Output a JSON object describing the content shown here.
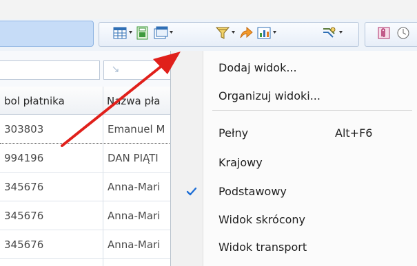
{
  "toolbar": {
    "buttons": [
      {
        "name": "columns-icon",
        "color": "#2f6fb5"
      },
      {
        "name": "export-icon",
        "color": "#3d9a3d"
      },
      {
        "name": "views-icon",
        "color": "#2f6fb5"
      },
      {
        "name": "filter-icon",
        "color": "#8a6d1f"
      },
      {
        "name": "arrow-action-icon",
        "color": "#e07a1f"
      },
      {
        "name": "chart-icon",
        "color": "#2f6fb5"
      },
      {
        "name": "tools-icon",
        "color": "#5a7a3a"
      },
      {
        "name": "attachment-icon",
        "color": "#b0306a"
      }
    ]
  },
  "grid": {
    "headers": [
      "bol płatnika",
      "Nazwa pła"
    ],
    "rows": [
      {
        "c1": "303803",
        "c2": "Emanuel M"
      },
      {
        "c1": "994196",
        "c2": "DAN PIĄTI"
      },
      {
        "c1": "345676",
        "c2": "Anna-Mari"
      },
      {
        "c1": "345676",
        "c2": "Anna-Mari"
      },
      {
        "c1": "345676",
        "c2": "Anna-Mari"
      }
    ]
  },
  "menu": {
    "items": {
      "add_view": "Dodaj widok...",
      "organize_views": "Organizuj widoki...",
      "full": "Pełny",
      "full_shortcut": "Alt+F6",
      "national": "Krajowy",
      "basic": "Podstawowy",
      "short": "Widok skrócony",
      "transport": "Widok transport"
    },
    "checked": "Podstawowy",
    "check_color": "#1f6fd6"
  },
  "annotation": {
    "arrow_color": "#e0201b"
  }
}
